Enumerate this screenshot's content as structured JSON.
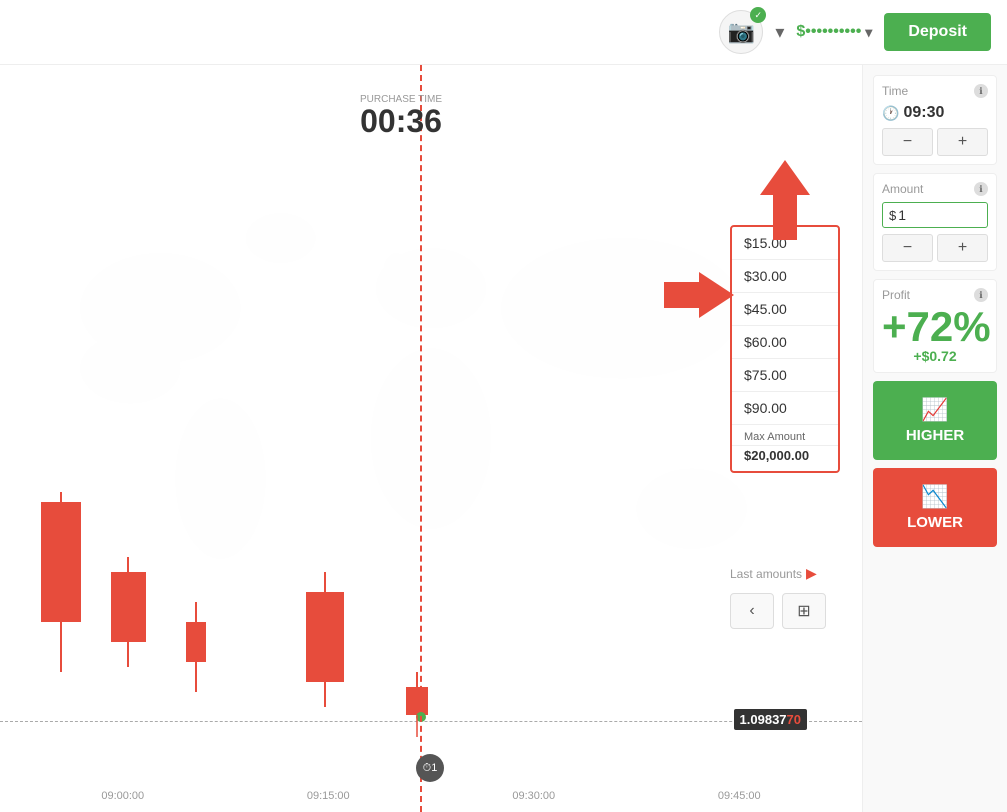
{
  "header": {
    "deposit_label": "Deposit",
    "balance": "$••••••••••",
    "camera_check": "✓"
  },
  "chart": {
    "purchase_time_label": "PURCHASE TIME",
    "purchase_time_value": "00:36",
    "price_value": "1.09837",
    "price_highlight": "70",
    "x_labels": [
      "09:00:00",
      "09:15:00",
      "09:30:00",
      "09:45:00"
    ],
    "timer_text": "⏱1"
  },
  "amount_dropdown": {
    "items": [
      "$15.00",
      "$30.00",
      "$45.00",
      "$60.00",
      "$75.00",
      "$90.00"
    ],
    "max_label": "Max Amount",
    "max_value": "$20,000.00",
    "last_amounts": "Last amounts",
    "arrow": "▶"
  },
  "nav": {
    "back": "‹",
    "calculator": "⊞"
  },
  "right_panel": {
    "time_section": {
      "title": "Time",
      "value": "09:30",
      "minus": "−",
      "plus": "+"
    },
    "amount_section": {
      "title": "Amount",
      "currency": "$",
      "value": "1",
      "minus": "−",
      "plus": "+"
    },
    "profit_section": {
      "title": "Profit",
      "percentage": "+72%",
      "dollar": "+$0.72"
    },
    "higher_btn": "HIGHER",
    "lower_btn": "LOWER"
  }
}
